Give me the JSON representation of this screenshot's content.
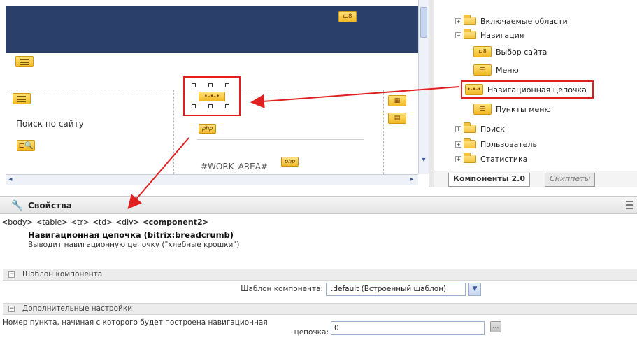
{
  "editor": {
    "search_label": "Поиск по сайту",
    "work_area": "#WORK_AREA#",
    "php_badge": "php",
    "breadcrumb_icon_glyph": "•-•-•"
  },
  "tree": {
    "items": [
      {
        "label": "Включаемые области",
        "icon": "folder-icon",
        "expander": "+"
      },
      {
        "label": "Навигация",
        "icon": "folder-open-icon",
        "expander": "−"
      },
      {
        "label": "Выбор сайта",
        "icon": "site-select-icon"
      },
      {
        "label": "Меню",
        "icon": "menu-icon"
      },
      {
        "label": "Навигационная цепочка",
        "icon": "breadcrumb-icon",
        "icon_glyph": "•-•-•"
      },
      {
        "label": "Пункты меню",
        "icon": "menu-items-icon"
      },
      {
        "label": "Поиск",
        "icon": "folder-icon",
        "expander": "+"
      },
      {
        "label": "Пользователь",
        "icon": "folder-icon",
        "expander": "+"
      },
      {
        "label": "Статистика",
        "icon": "folder-icon",
        "expander": "+"
      }
    ],
    "tabs": {
      "components": "Компоненты 2.0",
      "snippets": "Сниппеты"
    }
  },
  "properties": {
    "title": "Свойства",
    "path_prefix": "<body> <table> <tr> <td> <div> ",
    "path_last": "<component2>",
    "component_name": "Навигационная цепочка (bitrix:breadcrumb)",
    "component_desc": "Выводит навигационную цепочку (\"хлебные крошки\")",
    "section_template": "Шаблон компонента",
    "template_label": "Шаблон компонента:",
    "template_value": ".default (Встроенный шаблон)",
    "section_extra": "Дополнительные настройки",
    "start_item_label_line1": "Номер пункта, начиная с которого будет построена навигационная",
    "start_item_label_line2": "цепочка:",
    "start_item_value": "0"
  },
  "colors": {
    "header_navy": "#2b3f6b",
    "highlight_red": "#e02020",
    "component_yellow": "#f2b823"
  }
}
